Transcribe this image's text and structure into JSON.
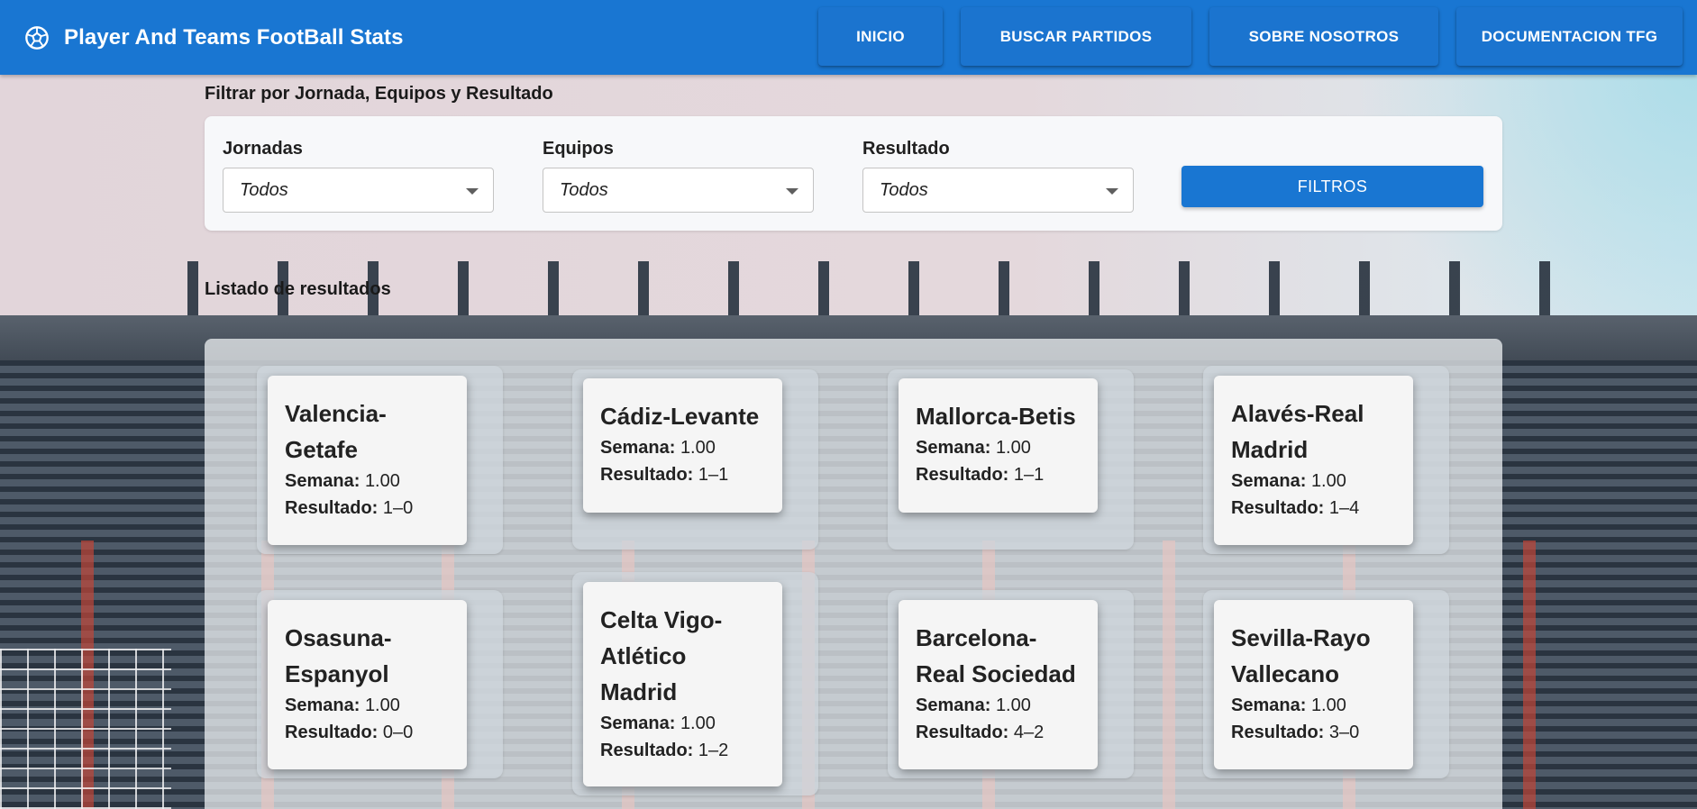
{
  "header": {
    "title": "Player And Teams FootBall Stats",
    "logo_icon": "soccer-ball-icon",
    "nav": [
      {
        "label": "INICIO"
      },
      {
        "label": "BUSCAR PARTIDOS"
      },
      {
        "label": "SOBRE NOSOTROS"
      },
      {
        "label": "DOCUMENTACION TFG"
      }
    ]
  },
  "filters": {
    "section_title": "Filtrar por Jornada, Equipos y Resultado",
    "jornadas": {
      "label": "Jornadas",
      "value": "Todos"
    },
    "equipos": {
      "label": "Equipos",
      "value": "Todos"
    },
    "resultado": {
      "label": "Resultado",
      "value": "Todos"
    },
    "button_label": "FILTROS"
  },
  "results": {
    "section_title": "Listado de resultados",
    "semana_label": "Semana:",
    "resultado_label": "Resultado:",
    "matches": [
      {
        "title": "Valencia-Getafe",
        "semana": "1.00",
        "resultado": "1–0"
      },
      {
        "title": "Cádiz-Levante",
        "semana": "1.00",
        "resultado": "1–1"
      },
      {
        "title": "Mallorca-Betis",
        "semana": "1.00",
        "resultado": "1–1"
      },
      {
        "title": "Alavés-Real Madrid",
        "semana": "1.00",
        "resultado": "1–4"
      },
      {
        "title": "Osasuna-Espanyol",
        "semana": "1.00",
        "resultado": "0–0"
      },
      {
        "title": "Celta Vigo-Atlético Madrid",
        "semana": "1.00",
        "resultado": "1–2"
      },
      {
        "title": "Barcelona-Real Sociedad",
        "semana": "1.00",
        "resultado": "4–2"
      },
      {
        "title": "Sevilla-Rayo Vallecano",
        "semana": "1.00",
        "resultado": "3–0"
      }
    ]
  },
  "colors": {
    "primary": "#1976d2",
    "card": "#f5f5f5"
  }
}
